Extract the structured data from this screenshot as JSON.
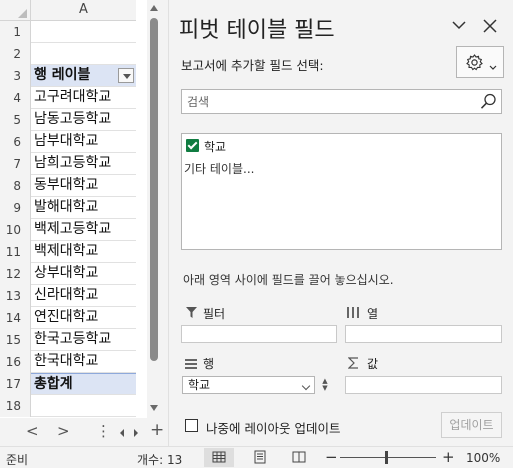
{
  "sheet": {
    "column_header": "A",
    "rows": [
      {
        "num": "1",
        "text": "",
        "style": ""
      },
      {
        "num": "2",
        "text": "",
        "style": ""
      },
      {
        "num": "3",
        "text": "행 레이블",
        "style": "hdr"
      },
      {
        "num": "4",
        "text": "고구려대학교",
        "style": ""
      },
      {
        "num": "5",
        "text": "남동고등학교",
        "style": ""
      },
      {
        "num": "6",
        "text": "남부대학교",
        "style": ""
      },
      {
        "num": "7",
        "text": "남희고등학교",
        "style": ""
      },
      {
        "num": "8",
        "text": "동부대학교",
        "style": ""
      },
      {
        "num": "9",
        "text": "발해대학교",
        "style": ""
      },
      {
        "num": "10",
        "text": "백제고등학교",
        "style": ""
      },
      {
        "num": "11",
        "text": "백제대학교",
        "style": ""
      },
      {
        "num": "12",
        "text": "상부대학교",
        "style": ""
      },
      {
        "num": "13",
        "text": "신라대학교",
        "style": ""
      },
      {
        "num": "14",
        "text": "연진대학교",
        "style": ""
      },
      {
        "num": "15",
        "text": "한국고등학교",
        "style": ""
      },
      {
        "num": "16",
        "text": "한국대학교",
        "style": ""
      },
      {
        "num": "17",
        "text": "총합계",
        "style": "total"
      },
      {
        "num": "18",
        "text": "",
        "style": ""
      }
    ]
  },
  "tabs": {
    "prev": "<",
    "next": ">",
    "more": "⋮",
    "add": "+"
  },
  "pane": {
    "title": "피벗 테이블 필드",
    "subtitle": "보고서에 추가할 필드 선택:",
    "search_placeholder": "검색",
    "fields": [
      {
        "label": "학교",
        "checked": true
      }
    ],
    "more_tables": "기타 테이블...",
    "drag_hint": "아래 영역 사이에 필드를 끌어 놓으십시오.",
    "areas": {
      "filter": "필터",
      "columns": "열",
      "rows": "행",
      "values": "값"
    },
    "row_field": "학교",
    "defer_label": "나중에 레이아웃 업데이트",
    "update_button": "업데이트"
  },
  "status": {
    "ready": "준비",
    "count": "개수: 13",
    "zoom_minus": "−",
    "zoom_plus": "+",
    "zoom": "100%"
  },
  "colors": {
    "accent_green": "#107c41",
    "pivot_header": "#dce4f4"
  }
}
